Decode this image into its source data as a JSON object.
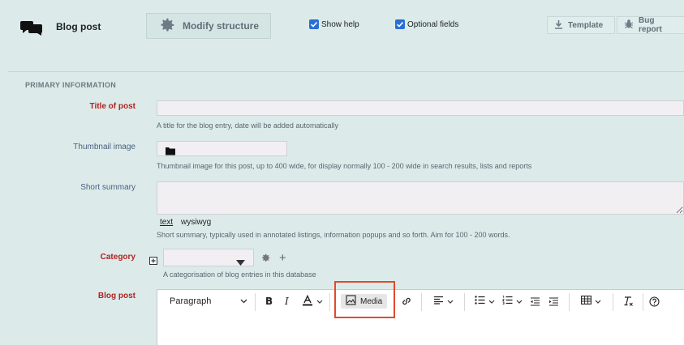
{
  "header": {
    "title": "Blog post",
    "modify_structure": "Modify structure",
    "show_help": "Show help",
    "optional_fields": "Optional fields",
    "template": "Template",
    "bug_report": "Bug report"
  },
  "section": {
    "title": "PRIMARY INFORMATION"
  },
  "fields": {
    "title": {
      "label": "Title of post",
      "value": "",
      "help": "A title for the blog entry, date will be added automatically"
    },
    "thumbnail": {
      "label": "Thumbnail image",
      "help": "Thumbnail image for this post, up to 400 wide, for display normally 100 - 200 wide in search results, lists and reports"
    },
    "summary": {
      "label": "Short summary",
      "value": "",
      "mode_text": "text",
      "mode_wysiwyg": "wysiwyg",
      "help": "Short summary, typically used in annotated listings, information popups and so forth. Aim for 100 - 200 words."
    },
    "category": {
      "label": "Category",
      "selected": "",
      "add_symbol": "+",
      "help": "A categorisation of blog entries in this database"
    },
    "blog_post": {
      "label": "Blog post",
      "block_format": "Paragraph",
      "media_label": "Media"
    }
  },
  "colors": {
    "background": "#dcebea",
    "required_label": "#b22222",
    "checkbox": "#2b6ed6",
    "highlight": "#e4492c"
  }
}
